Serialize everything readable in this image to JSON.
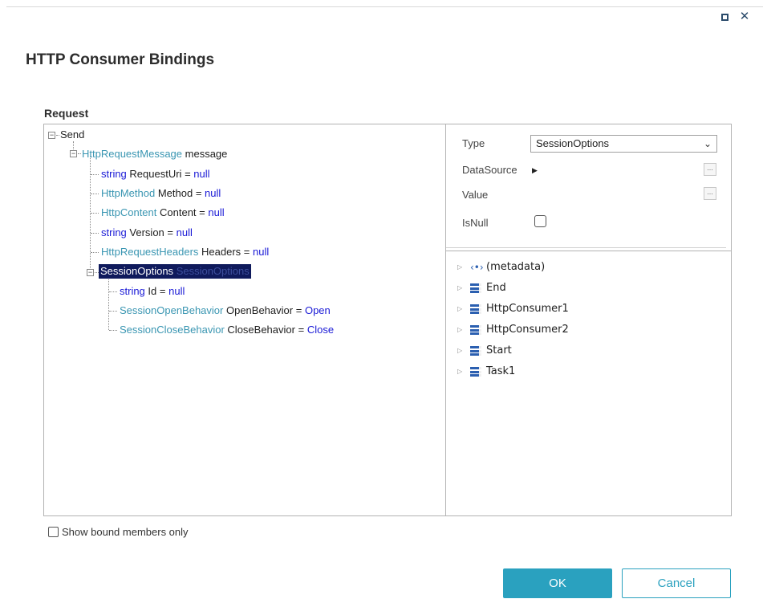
{
  "window": {
    "title": "HTTP Consumer Bindings",
    "maximize_icon": "maximize-icon",
    "close_icon": "close-icon"
  },
  "request": {
    "label": "Request",
    "tree": {
      "root": "Send",
      "message": {
        "type": "HttpRequestMessage",
        "name": "message"
      },
      "members": [
        {
          "type": "string",
          "name": "RequestUri",
          "eq": "=",
          "value": "null",
          "type_kind": "keyword"
        },
        {
          "type": "HttpMethod",
          "name": "Method",
          "eq": "=",
          "value": "null",
          "type_kind": "class"
        },
        {
          "type": "HttpContent",
          "name": "Content",
          "eq": "=",
          "value": "null",
          "type_kind": "class"
        },
        {
          "type": "string",
          "name": "Version",
          "eq": "=",
          "value": "null",
          "type_kind": "keyword"
        },
        {
          "type": "HttpRequestHeaders",
          "name": "Headers",
          "eq": "=",
          "value": "null",
          "type_kind": "class"
        }
      ],
      "selected": {
        "type": "SessionOptions",
        "name": "SessionOptions"
      },
      "session_members": [
        {
          "type": "string",
          "name": "Id",
          "eq": "=",
          "value": "null",
          "type_kind": "keyword"
        },
        {
          "type": "SessionOpenBehavior",
          "name": "OpenBehavior",
          "eq": "=",
          "value": "Open",
          "type_kind": "class"
        },
        {
          "type": "SessionCloseBehavior",
          "name": "CloseBehavior",
          "eq": "=",
          "value": "Close",
          "type_kind": "class"
        }
      ]
    }
  },
  "properties": {
    "type_label": "Type",
    "type_value": "SessionOptions",
    "datasource_label": "DataSource",
    "value_label": "Value",
    "isnull_label": "IsNull",
    "ellipsis": "..."
  },
  "context_tree": [
    {
      "label": "(metadata)",
      "icon": "metadata-icon"
    },
    {
      "label": "End",
      "icon": "activity-icon"
    },
    {
      "label": "HttpConsumer1",
      "icon": "activity-icon"
    },
    {
      "label": "HttpConsumer2",
      "icon": "activity-icon"
    },
    {
      "label": "Start",
      "icon": "activity-icon"
    },
    {
      "label": "Task1",
      "icon": "activity-icon"
    }
  ],
  "show_bound_label": "Show bound members only",
  "buttons": {
    "ok": "OK",
    "cancel": "Cancel"
  },
  "colors": {
    "accent": "#2aa1bf",
    "selection": "#0f1a5c",
    "type_text": "#3a96b2",
    "keyword_text": "#1a1ad6"
  }
}
